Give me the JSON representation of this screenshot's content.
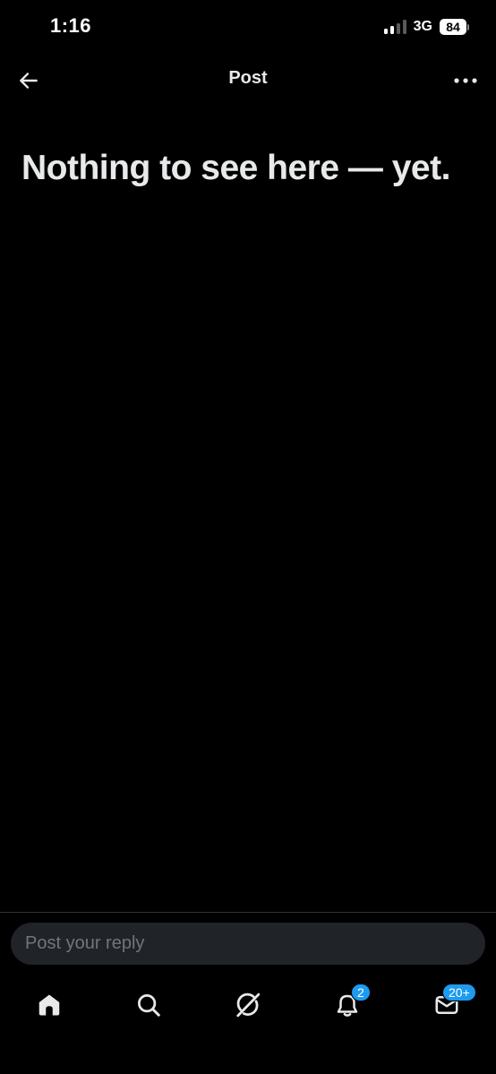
{
  "status_bar": {
    "time": "1:16",
    "network": "3G",
    "battery": "84"
  },
  "header": {
    "title": "Post",
    "back_icon": "arrow-left-icon",
    "more_icon": "more-horizontal-icon"
  },
  "main": {
    "empty_title": "Nothing to see here — yet."
  },
  "reply": {
    "placeholder": "Post your reply"
  },
  "nav": {
    "items": [
      {
        "icon": "home-icon"
      },
      {
        "icon": "search-icon"
      },
      {
        "icon": "grok-icon"
      },
      {
        "icon": "bell-icon",
        "badge": "2"
      },
      {
        "icon": "mail-icon",
        "badge": "20+"
      }
    ]
  },
  "colors": {
    "background": "#000000",
    "text": "#e7e9ea",
    "placeholder": "#71767b",
    "input_background": "#202327",
    "accent": "#1d9bf0"
  }
}
